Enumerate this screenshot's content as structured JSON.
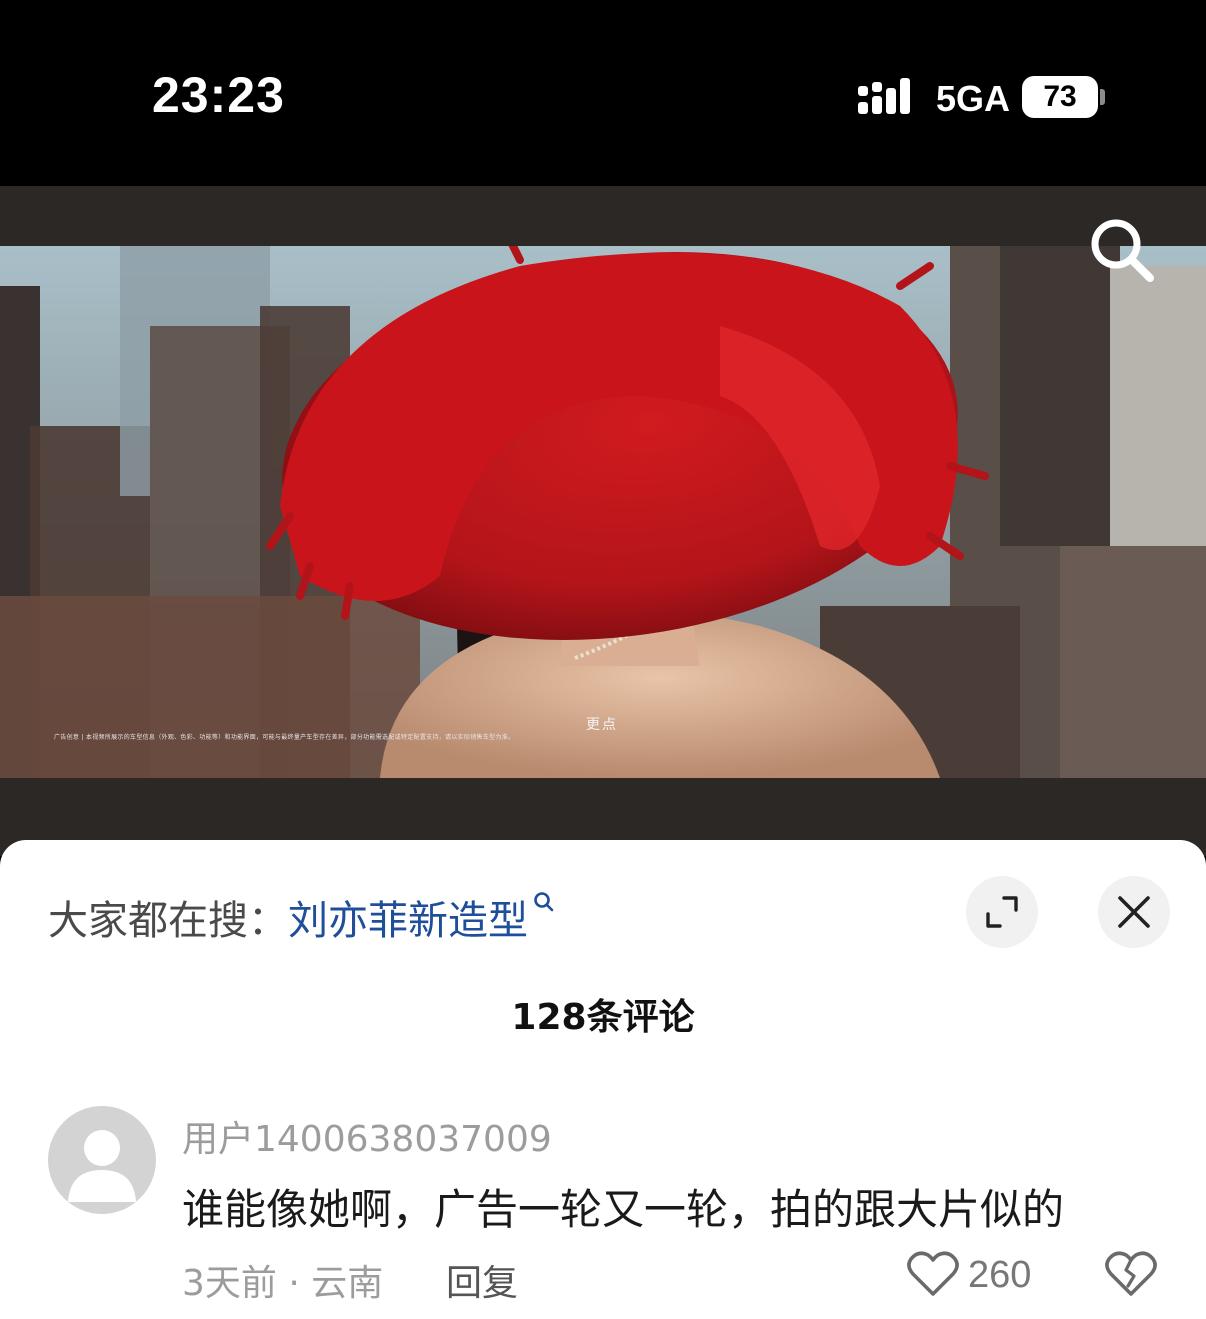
{
  "status_bar": {
    "time": "23:23",
    "network": "5GA",
    "battery": "73"
  },
  "video": {
    "caption": "更点",
    "disclaimer": "广告创意 | 本视频所展示的车型信息（外观、色彩、功能等）和功能界面，可能与最终量产车型存在差异，部分功能需选配或特定配置支持，请以实际销售车型为准。"
  },
  "comments_panel": {
    "trending_prefix": "大家都在搜：",
    "trending_keyword": "刘亦菲新造型",
    "comment_count": "128条评论",
    "comments": [
      {
        "username": "用户1400638037009",
        "text": "谁能像她啊，广告一轮又一轮，拍的跟大片似的",
        "meta": "3天前 · 云南",
        "reply_label": "回复",
        "likes": "260"
      }
    ]
  },
  "colors": {
    "accent_link": "#1f4e9a",
    "hat_red": "#c8141a"
  },
  "icons": [
    "signal-icon",
    "search-icon",
    "expand-icon",
    "close-icon",
    "heart-icon",
    "broken-heart-icon",
    "avatar-placeholder-icon"
  ]
}
